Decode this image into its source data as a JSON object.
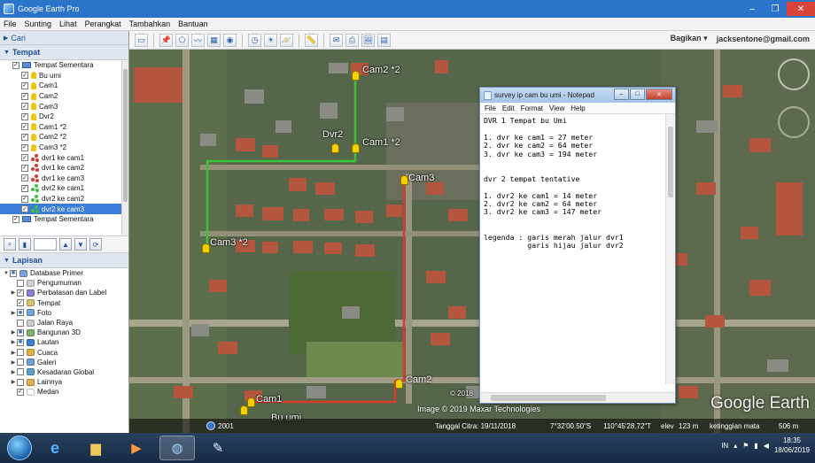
{
  "window": {
    "title": "Google Earth Pro"
  },
  "menu": [
    "File",
    "Sunting",
    "Lihat",
    "Perangkat",
    "Tambahkan",
    "Bantuan"
  ],
  "search": {
    "label": "Cari"
  },
  "places": {
    "label": "Tempat",
    "items": [
      {
        "label": "Tempat Sementara",
        "icon": "folder",
        "checked": true
      },
      {
        "label": "Bu umi",
        "icon": "pin",
        "checked": true
      },
      {
        "label": "Cam1",
        "icon": "pin",
        "checked": true
      },
      {
        "label": "Cam2",
        "icon": "pin",
        "checked": true
      },
      {
        "label": "Cam3",
        "icon": "pin",
        "checked": true
      },
      {
        "label": "Dvr2",
        "icon": "pin",
        "checked": true
      },
      {
        "label": "Cam1 *2",
        "icon": "pin",
        "checked": true
      },
      {
        "label": "Cam2 *2",
        "icon": "pin",
        "checked": true
      },
      {
        "label": "Cam3 *2",
        "icon": "pin",
        "checked": true
      },
      {
        "label": "dvr1 ke cam1",
        "icon": "path-red",
        "checked": true
      },
      {
        "label": "dvr1 ke cam2",
        "icon": "path-red",
        "checked": true
      },
      {
        "label": "dvr1 ke cam3",
        "icon": "path-red",
        "checked": true
      },
      {
        "label": "dvr2 ke cam1",
        "icon": "path-green",
        "checked": true
      },
      {
        "label": "dvr2 ke cam2",
        "icon": "path-green",
        "checked": true
      },
      {
        "label": "dvr2 ke cam3",
        "icon": "path-green",
        "checked": true,
        "selected": true
      },
      {
        "label": "Tempat Sementara",
        "icon": "folder",
        "checked": true
      }
    ]
  },
  "layers": {
    "label": "Lapisan",
    "items": [
      {
        "label": "Database Primer",
        "color": "#7aa4d8",
        "tri": "▼"
      },
      {
        "label": "Pengumuman",
        "color": "#d0d0d0",
        "tri": ""
      },
      {
        "label": "Perbatasan dan Label",
        "color": "#8f7bd0",
        "tri": "▶"
      },
      {
        "label": "Tempat",
        "color": "#d8c36a",
        "tri": ""
      },
      {
        "label": "Foto",
        "color": "#6ea7d9",
        "tri": "▶"
      },
      {
        "label": "Jalan Raya",
        "color": "#c9c9c9",
        "tri": ""
      },
      {
        "label": "Bangunan 3D",
        "color": "#7eb36a",
        "tri": "▶"
      },
      {
        "label": "Lautan",
        "color": "#3a82d1",
        "tri": "▶"
      },
      {
        "label": "Cuaca",
        "color": "#e6b23f",
        "tri": "▶"
      },
      {
        "label": "Galeri",
        "color": "#6fa0d6",
        "tri": "▶"
      },
      {
        "label": "Kesadaran Global",
        "color": "#5aa0cc",
        "tri": "▶"
      },
      {
        "label": "Lainnya",
        "color": "#e0b050",
        "tri": "▶"
      },
      {
        "label": "Medan",
        "color": "#ffffff",
        "tri": ""
      }
    ]
  },
  "toolbar": {
    "sign_in": "Bagikan",
    "account": "jacksentone@gmail.com"
  },
  "map": {
    "labels": {
      "cam2_2": "Cam2 *2",
      "dvr2": "Dvr2",
      "cam1_2": "Cam1 *2",
      "cam3": "Cam3",
      "cam3_2": "Cam3 *2",
      "cam2": "Cam2",
      "cam1": "Cam1",
      "bu_umi": "Bu umi"
    },
    "copyright": "Image © 2019 Maxar Technologies",
    "copyright_year": "© 2018",
    "watermark": "Google Earth",
    "year": "2001",
    "status": {
      "date": "Tanggal Citra: 19/11/2018",
      "lat": "7°32'00.50\"S",
      "lon": "110°45'28.72\"T",
      "elev_label": "elev",
      "elev": "123 m",
      "eye_label": "ketinggian mata",
      "eye": "506 m"
    }
  },
  "notepad": {
    "title": "survey ip cam bu umi - Notepad",
    "menu": [
      "File",
      "Edit",
      "Format",
      "View",
      "Help"
    ],
    "content": "DVR 1 Tempat bu Umi\n\n1. dvr ke cam1 = 27 meter\n2. dvr ke cam2 = 64 meter\n3. dvr ke cam3 = 194 meter\n\n\ndvr 2 tempat tentative\n\n1. dvr2 ke cam1 = 14 meter\n2. dvr2 ke cam2 = 64 meter\n3. dvr2 ke cam3 = 147 meter\n\n\nlegenda : garis merah jalur dvr1\n          garis hijau jalur dvr2"
  },
  "taskbar": {
    "tray_lang": "IN",
    "time": "18:35",
    "date": "18/06/2019"
  }
}
